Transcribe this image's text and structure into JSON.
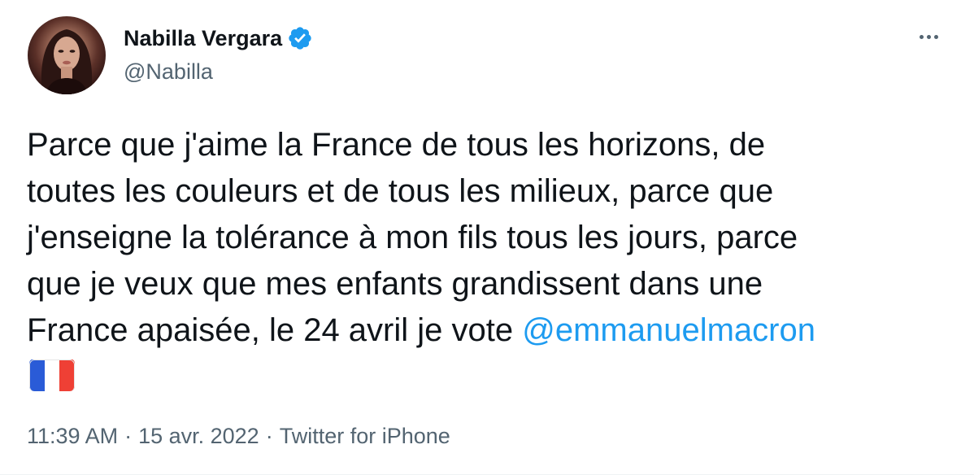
{
  "author": {
    "display_name": "Nabilla Vergara",
    "handle": "@Nabilla",
    "verified": true
  },
  "tweet": {
    "text_before": "Parce que j'aime la France de tous les horizons, de\ntoutes les couleurs et de tous les milieux, parce que\nj'enseigne la tolérance à mon fils tous les jours, parce\nque je veux que mes enfants grandissent dans une\nFrance apaisée, le 24 avril je vote ",
    "mention": "@emmanuelmacron",
    "emoji": "france-flag"
  },
  "meta": {
    "time": "11:39 AM",
    "separator": "·",
    "date": "15 avr. 2022",
    "source": "Twitter for iPhone"
  },
  "colors": {
    "text": "#0f1419",
    "secondary": "#536471",
    "accent": "#1d9bf0",
    "flag_blue": "#2a5bd7",
    "flag_white": "#ffffff",
    "flag_red": "#ef4035"
  },
  "icons": {
    "verified": "verified-badge-icon",
    "more": "more-options-icon"
  }
}
